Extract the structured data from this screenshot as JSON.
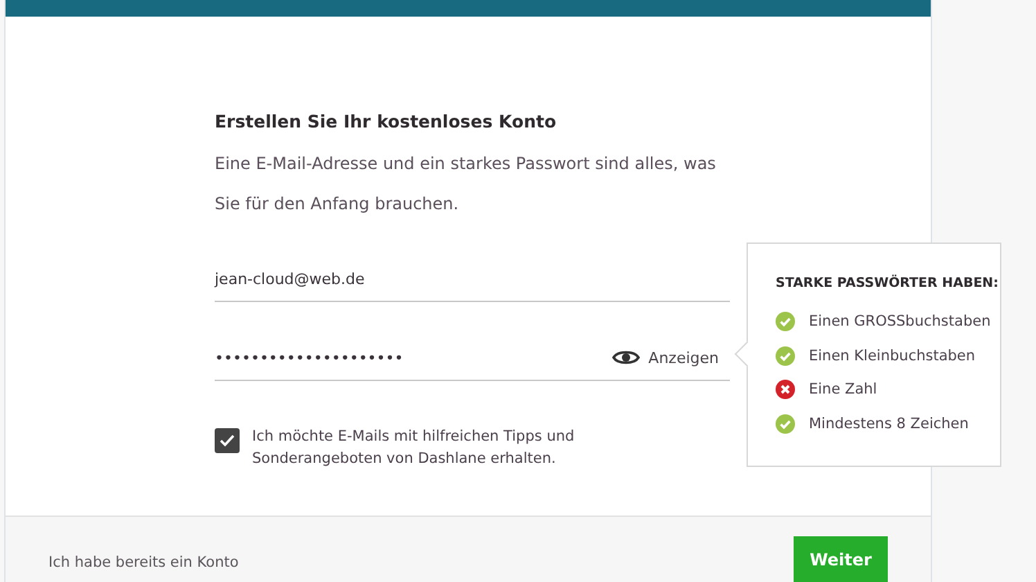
{
  "form": {
    "heading": "Erstellen Sie Ihr kostenloses Konto",
    "intro": "Eine E-Mail-Adresse und ein starkes Passwort sind alles, was Sie für den Anfang brauchen.",
    "email": {
      "value": "jean-cloud@web.de"
    },
    "password": {
      "value": "•••••••••••••••••••••",
      "reveal_label": "Anzeigen"
    },
    "newsletter": {
      "label": "Ich möchte E-Mails mit hilfreichen Tipps und Sonderangeboten von Dashlane erhalten.",
      "checked": true
    }
  },
  "password_tips": {
    "title": "STARKE PASSWÖRTER HABEN:",
    "rules": [
      {
        "label": "Einen GROSSbuchstaben",
        "met": true
      },
      {
        "label": "Einen Kleinbuchstaben",
        "met": true
      },
      {
        "label": "Eine Zahl",
        "met": false
      },
      {
        "label": "Mindestens 8 Zeichen",
        "met": true
      }
    ]
  },
  "footer": {
    "link": "Ich habe bereits ein Konto",
    "button": "Weiter"
  }
}
